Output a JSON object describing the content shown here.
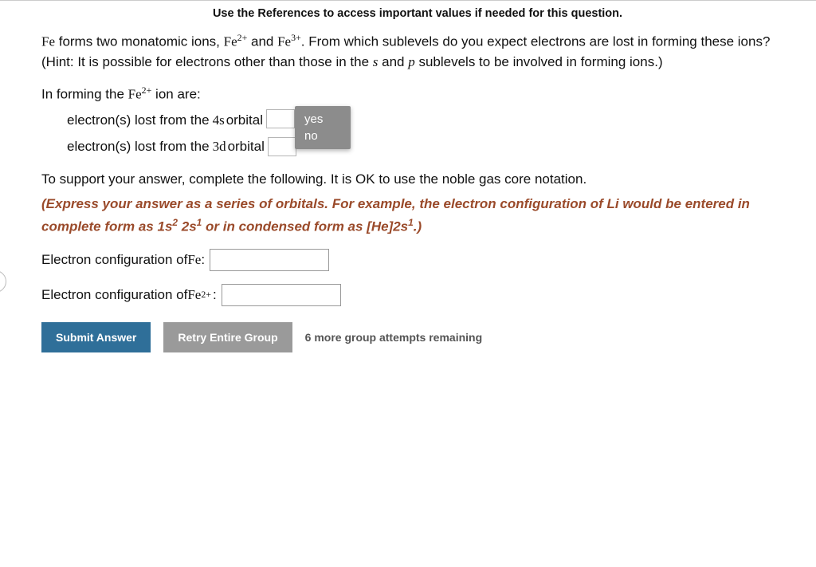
{
  "instruction": "Use the References to access important values if needed for this question.",
  "question": {
    "part1_pre": "Fe",
    "part1_text": " forms two monatomic ions, ",
    "ion1": "Fe",
    "ion1_charge": "2+",
    "and": " and ",
    "ion2": "Fe",
    "ion2_charge": "3+",
    "part1_rest": ". From which sublevels do you expect electrons are lost in forming these ions? (Hint: It is possible for electrons other than those in the ",
    "s_sym": "s",
    "and2": " and ",
    "p_sym": "p",
    "part1_end": " sublevels to be involved in forming ions.)",
    "forming_pre": "In forming the ",
    "forming_ion": "Fe",
    "forming_charge": "2+",
    "forming_post": " ion are:",
    "line_4s_pre": "electron(s) lost from the ",
    "orb_4s": "4s",
    "line_4s_post": " orbital",
    "line_3d_pre": "electron(s) lost from the ",
    "orb_3d": "3d",
    "line_3d_post": " orbital",
    "support": "To support your answer, complete the following. It is OK to use the noble gas core notation.",
    "hint_a": "(Express your answer as a series of orbitals. For example, the electron configuration of Li would be entered in complete form as 1s",
    "hint_sup1": "2",
    "hint_b": " 2s",
    "hint_sup2": "1",
    "hint_c": " or in condensed form as [He]2s",
    "hint_sup3": "1",
    "hint_d": ".)",
    "config_fe_label_pre": "Electron configuration of ",
    "config_fe_sym": "Fe",
    "config_fe_label_post": ":",
    "config_fe2_label_pre": "Electron configuration of ",
    "config_fe2_sym": "Fe",
    "config_fe2_charge": "2+",
    "config_fe2_label_post": ":"
  },
  "dropdown": {
    "opt_yes": "yes",
    "opt_no": "no"
  },
  "buttons": {
    "submit": "Submit Answer",
    "retry": "Retry Entire Group"
  },
  "attempts": "6 more group attempts remaining",
  "checkmark": "✓"
}
